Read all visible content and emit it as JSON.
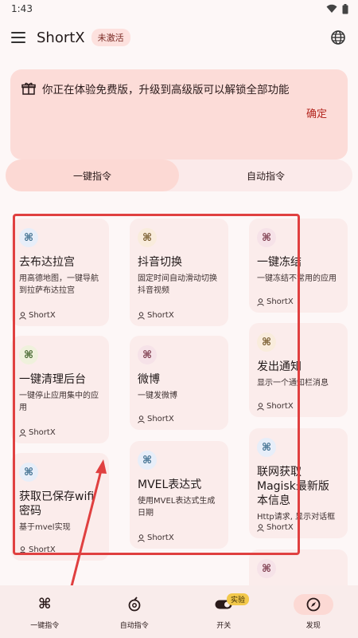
{
  "status": {
    "time": "1:43"
  },
  "app": {
    "title": "ShortX",
    "badge": "未激活"
  },
  "banner": {
    "text": "你正在体验免费版，升级到高级版可以解锁全部功能",
    "confirm": "确定"
  },
  "tabs": [
    {
      "label": "一键指令",
      "active": true
    },
    {
      "label": "自动指令",
      "active": false
    }
  ],
  "cards": {
    "c1": {
      "title": "去布达拉宫",
      "desc": "用高德地图，一键导航到拉萨布达拉宫",
      "author": "ShortX"
    },
    "c2": {
      "title": "抖音切换",
      "desc": "固定时间自动滑动切换抖音视频",
      "author": "ShortX"
    },
    "c3": {
      "title": "一键冻结",
      "desc": "一键冻结不常用的应用",
      "author": "ShortX"
    },
    "c4": {
      "title": "一键清理后台",
      "desc": "一键停止应用集中的应用",
      "author": "ShortX"
    },
    "c5": {
      "title": "微博",
      "desc": "一键发微博",
      "author": "ShortX"
    },
    "c6": {
      "title": "发出通知",
      "desc": "显示一个通知栏消息",
      "author": "ShortX"
    },
    "c7": {
      "title": "获取已保存wifi密码",
      "desc": "基于mvel实现",
      "author": "ShortX"
    },
    "c8": {
      "title": "MVEL表达式",
      "desc": "使用MVEL表达式生成日期",
      "author": "ShortX"
    },
    "c9": {
      "title": "联网获取Magisk最新版本信息",
      "desc": "Http请求, 显示对话框",
      "author": "ShortX"
    }
  },
  "nav": [
    {
      "label": "一键指令"
    },
    {
      "label": "自动指令"
    },
    {
      "label": "开关",
      "badge": "实验"
    },
    {
      "label": "发现",
      "active": true
    }
  ],
  "colors": {
    "accent": "#b3261e",
    "highlight": "#e04040"
  }
}
